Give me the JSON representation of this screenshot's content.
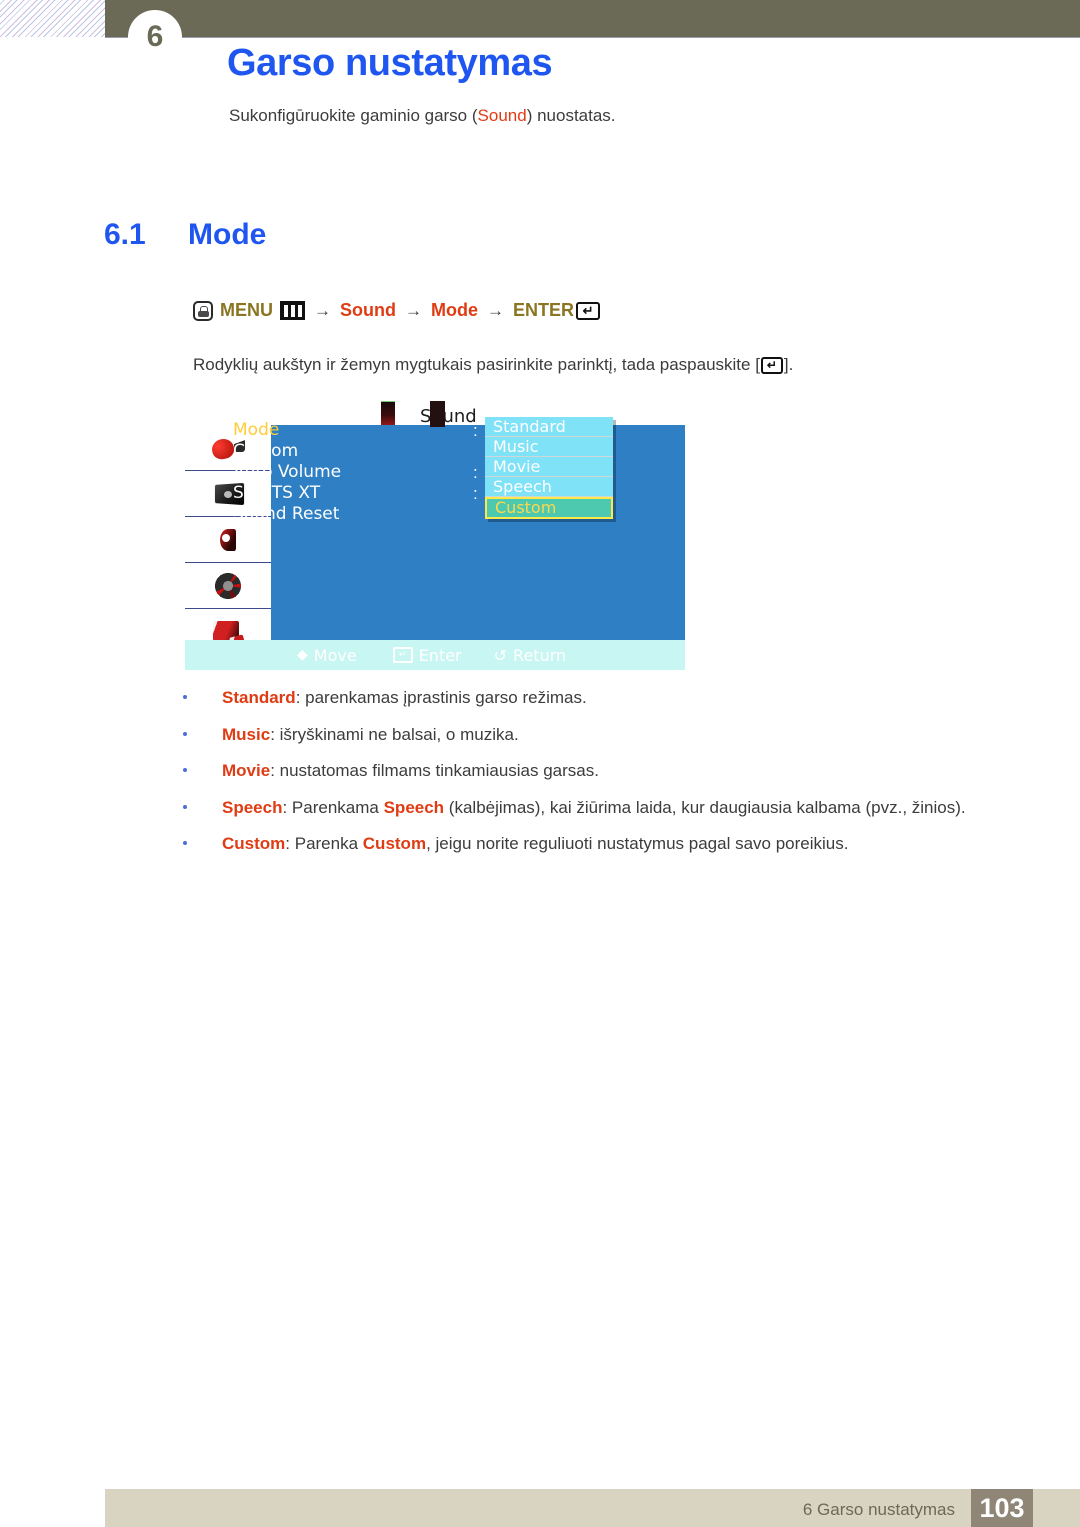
{
  "header": {
    "chapter_badge": "6",
    "title": "Garso nustatymas",
    "subtitle_before": "Sukonfigūruokite gaminio garso (",
    "subtitle_highlight": "Sound",
    "subtitle_after": ") nuostatas."
  },
  "section": {
    "number": "6.1",
    "title": "Mode"
  },
  "menu_path": {
    "menu_label": "MENU",
    "arrow": "→",
    "step1": "Sound",
    "step2": "Mode",
    "enter_label": "ENTER",
    "enter_glyph": "↵",
    "hand_icon": "hand-press-icon",
    "bars_icon": "menu-bars-icon"
  },
  "instruction": {
    "before": "Rodyklių aukštyn ir žemyn mygtukais pasirinkite parinktį, tada paspauskite [",
    "key_glyph": "↵",
    "after": "]."
  },
  "osd": {
    "title": "Sound",
    "sidebar_icons": [
      "picture-icon",
      "screen-adjustment-icon",
      "sound-icon",
      "system-gear-icon",
      "support-book-icon"
    ],
    "rows": [
      {
        "label": "Mode",
        "selected": true,
        "has_colon": true
      },
      {
        "label": "Custom",
        "selected": false,
        "has_colon": false
      },
      {
        "label": "Auto Volume",
        "selected": false,
        "has_colon": true
      },
      {
        "label": "SRS TS XT",
        "selected": false,
        "has_colon": true
      },
      {
        "label": "Sound Reset",
        "selected": false,
        "has_colon": false
      }
    ],
    "dropdown": [
      {
        "label": "Standard",
        "active": false
      },
      {
        "label": "Music",
        "active": false
      },
      {
        "label": "Movie",
        "active": false
      },
      {
        "label": "Speech",
        "active": false
      },
      {
        "label": "Custom",
        "active": true
      }
    ],
    "footer": [
      {
        "glyph": "updown-arrow-icon",
        "label": "Move"
      },
      {
        "glyph": "enter-key-icon",
        "label": "Enter"
      },
      {
        "glyph": "return-arrow-icon",
        "label": "Return"
      }
    ],
    "colors": {
      "panel_blue": "#2e7fc4",
      "dropdown_cyan": "#7fe2f7",
      "dropdown_active": "#4cc9ae",
      "dropdown_active_border": "#ffe94a",
      "selected_text": "#ffcd38",
      "footer_bar": "#c8f6f2"
    }
  },
  "bullets": [
    {
      "term": "Standard",
      "text": ": parenkamas įprastinis garso režimas."
    },
    {
      "term": "Music",
      "text": ": išryškinami ne balsai, o muzika."
    },
    {
      "term": "Movie",
      "text": ": nustatomas filmams tinkamiausias garsas."
    },
    {
      "term": "Speech",
      "text": ": Parenkama ",
      "term2": "Speech",
      "text2": " (kalbėjimas), kai žiūrima laida, kur daugiausia kalbama (pvz., žinios)."
    },
    {
      "term": "Custom",
      "text": ": Parenka ",
      "term2": "Custom",
      "text2": ", jeigu norite reguliuoti nustatymus pagal savo poreikius."
    }
  ],
  "footer": {
    "text": "6 Garso nustatymas",
    "page": "103"
  },
  "colors": {
    "heading_blue": "#1f56f0",
    "accent_red": "#e03c14",
    "olive": "#6b6a56",
    "menu_olive": "#8a7520",
    "footer_beige": "#d9d4c1",
    "page_box": "#8f8677"
  }
}
